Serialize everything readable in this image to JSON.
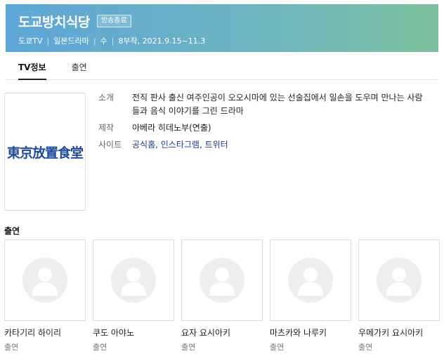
{
  "header": {
    "title": "도교방치식당",
    "badge": "방송종료",
    "meta": [
      "도쿄TV",
      "일본드라마",
      "수",
      "8부작, 2021.9.15~11.3"
    ],
    "separator": "|"
  },
  "tabs": [
    {
      "label": "TV정보",
      "active": true
    },
    {
      "label": "출연",
      "active": false
    }
  ],
  "poster": {
    "text": "東京放置食堂"
  },
  "info": {
    "intro_label": "소개",
    "intro_value": "전직 판사 출신 여주인공이 오오시마에 있는 선술집에서 일손을 도우며 만나는 사람들과 음식 이야기를 그린 드라마",
    "production_label": "제작",
    "production_value": "아베라 히데노부(연출)",
    "site_label": "사이트",
    "site_value": "공식홈, 인스타그램, 트위터"
  },
  "cast": {
    "heading": "출연",
    "members": [
      {
        "name": "카타기리 하이리",
        "role": "출연"
      },
      {
        "name": "쿠도 아야노",
        "role": "출연"
      },
      {
        "name": "요자 요시아키",
        "role": "출연"
      },
      {
        "name": "마츠카와 나루키",
        "role": "출연"
      },
      {
        "name": "우메가키 요시아키",
        "role": "출연"
      }
    ]
  },
  "colors": {
    "header_gradient_start": "#5ea6d8",
    "header_gradient_end": "#7dc09e",
    "link": "#1a3c8c",
    "poster_text": "#1e4b9c"
  },
  "icons": {
    "cast_placeholder": "person-placeholder-icon"
  }
}
